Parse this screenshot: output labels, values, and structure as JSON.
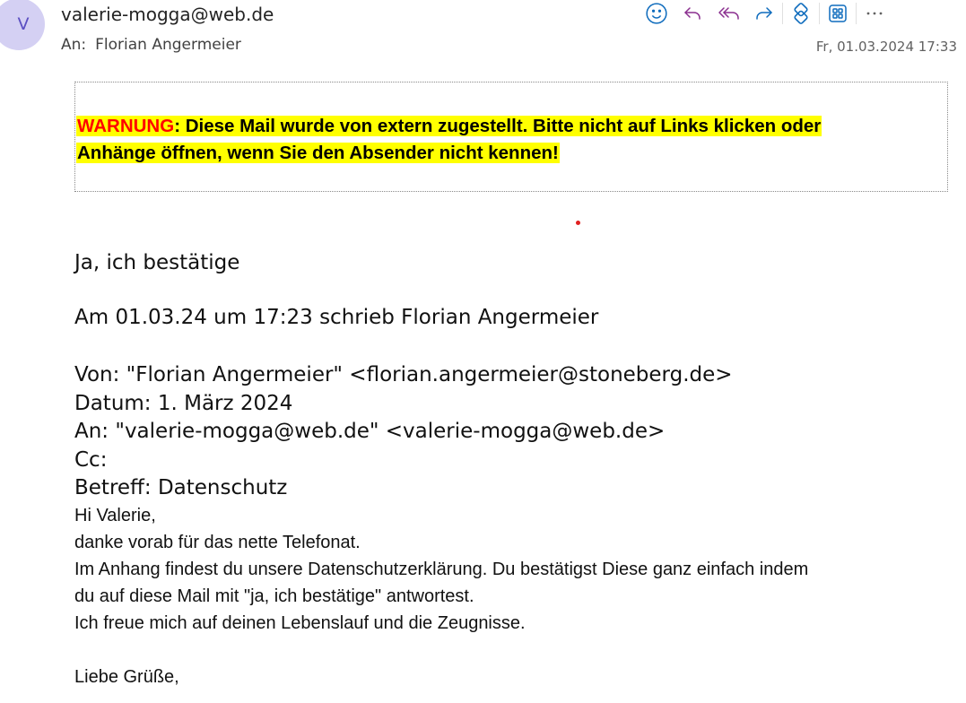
{
  "header": {
    "avatar_initial": "V",
    "sender": "valerie-mogga@web.de",
    "to_label": "An:",
    "to_name": "Florian Angermeier",
    "date": "Fr, 01.03.2024 17:33"
  },
  "toolbar": {
    "icons": [
      "emoji-icon",
      "reply-icon",
      "reply-all-icon",
      "forward-icon",
      "apps-icon",
      "grid-icon",
      "more-icon"
    ],
    "accent": "#0f6cbd"
  },
  "warning": {
    "label": "WARNUNG",
    "line1_rest": ": Diese Mail wurde von extern zugestellt. Bitte nicht auf Links klicken oder",
    "line2": "Anhänge öffnen, wenn Sie den Absender nicht kennen!",
    "highlight_color": "#ffff00",
    "label_color": "#ff0000"
  },
  "body": {
    "reply": "Ja, ich bestätige",
    "quote_intro": "Am 01.03.24 um 17:23 schrieb Florian Angermeier",
    "from_line": "Von: \"Florian Angermeier\" <florian.angermeier@stoneberg.de>",
    "date_line": "Datum: 1. März 2024",
    "to_line": "An: \"valerie-mogga@web.de\" <valerie-mogga@web.de>",
    "cc_line": "Cc:",
    "subject_line": "Betreff: Datenschutz",
    "greeting": "Hi Valerie,",
    "line1": "danke vorab für das nette Telefonat.",
    "line2": "Im Anhang findest du unsere Datenschutzerklärung. Du bestätigst Diese ganz einfach indem",
    "line3": "du auf diese Mail mit \"ja, ich bestätige\" antwortest.",
    "line4": "Ich freue mich auf deinen Lebenslauf und die Zeugnisse.",
    "closing": "Liebe Grüße,"
  }
}
